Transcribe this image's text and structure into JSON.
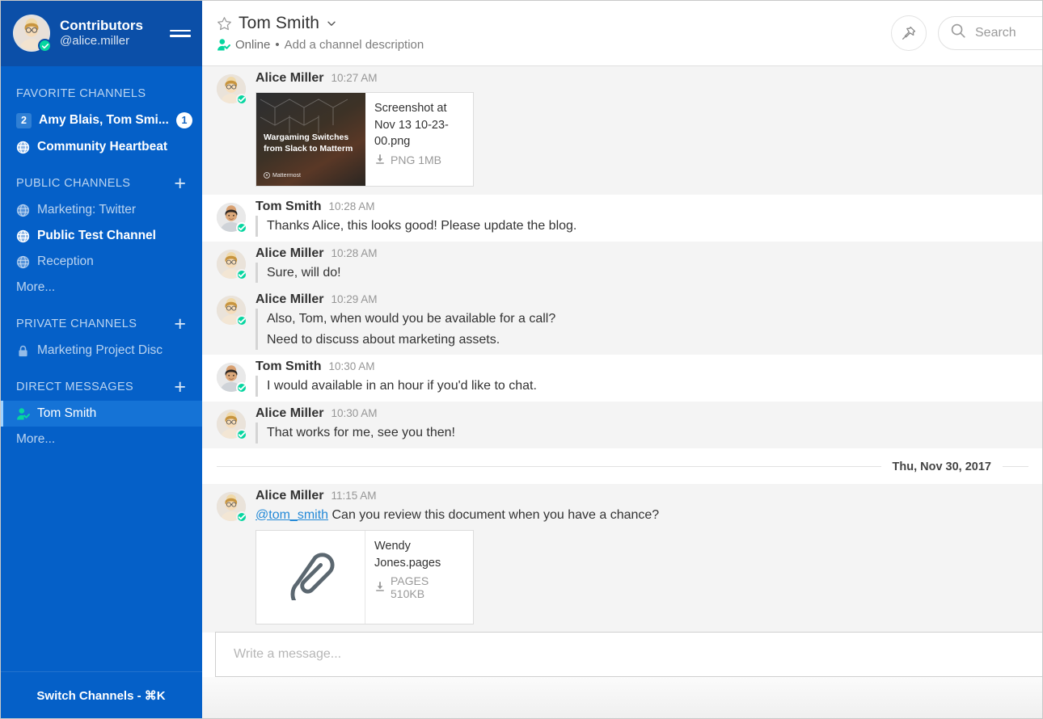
{
  "colors": {
    "sidebar_bg": "#0560c8",
    "sidebar_header_bg": "#0b4fa8",
    "sidebar_active": "#1573d6",
    "online_green": "#06d6a0",
    "mention_link": "#2389d7",
    "post_highlight": "#f4f4f4"
  },
  "sidebar": {
    "team_name": "Contributors",
    "user_handle": "@alice.miller",
    "menu_icon": "hamburger-icon",
    "categories": [
      {
        "label": "FAVORITE CHANNELS",
        "has_add": false,
        "add_label": "+",
        "items": [
          {
            "name": "Amy Blais, Tom Smi...",
            "icon": "group-count-icon",
            "count": "2",
            "mentions": "1",
            "unread": true,
            "active": false
          },
          {
            "name": "Community Heartbeat",
            "icon": "globe-icon",
            "unread": true,
            "active": false
          }
        ],
        "more": null
      },
      {
        "label": "PUBLIC CHANNELS",
        "has_add": true,
        "add_label": "+",
        "items": [
          {
            "name": "Marketing: Twitter",
            "icon": "globe-icon",
            "unread": false,
            "active": false
          },
          {
            "name": "Public Test Channel",
            "icon": "globe-icon",
            "unread": true,
            "active": false
          },
          {
            "name": "Reception",
            "icon": "globe-icon",
            "unread": false,
            "active": false
          }
        ],
        "more": "More..."
      },
      {
        "label": "PRIVATE CHANNELS",
        "has_add": true,
        "add_label": "+",
        "items": [
          {
            "name": "Marketing Project Disc",
            "icon": "lock-icon",
            "unread": false,
            "active": false
          }
        ],
        "more": null
      },
      {
        "label": "DIRECT MESSAGES",
        "has_add": true,
        "add_label": "+",
        "items": [
          {
            "name": "Tom Smith",
            "icon": "online-person-icon",
            "unread": false,
            "active": true
          }
        ],
        "more": "More..."
      }
    ],
    "footer_label": "Switch Channels - ⌘K"
  },
  "channel_header": {
    "favorite_icon": "star-icon",
    "title": "Tom Smith",
    "dropdown_icon": "chevron-down-icon",
    "status_icon": "online-person-icon",
    "status_text": "Online",
    "separator": "•",
    "description_placeholder": "Add a channel description",
    "pin_icon": "pin-icon",
    "search_icon": "search-icon",
    "search_placeholder": "Search",
    "search_value": ""
  },
  "posts": [
    {
      "author": "Alice Miller",
      "avatar": "alice",
      "time": "10:27 AM",
      "highlight": true,
      "lines": [],
      "attachment": {
        "kind": "image",
        "thumb_title": "Wargaming Switches from Slack to Matterm",
        "thumb_brand": "Mattermost",
        "name": "Screenshot at Nov 13 10-23-00.png",
        "meta": "PNG 1MB",
        "download_icon": "download-icon"
      }
    },
    {
      "author": "Tom Smith",
      "avatar": "tom",
      "time": "10:28 AM",
      "highlight": false,
      "lines": [
        "Thanks Alice, this looks good! Please update the blog."
      ],
      "attachment": null
    },
    {
      "author": "Alice Miller",
      "avatar": "alice",
      "time": "10:28 AM",
      "highlight": true,
      "lines": [
        "Sure, will do!"
      ],
      "attachment": null
    },
    {
      "author": "Alice Miller",
      "avatar": "alice",
      "time": "10:29 AM",
      "highlight": true,
      "lines": [
        "Also, Tom, when would you be available for a call?",
        "Need to discuss about marketing assets."
      ],
      "attachment": null
    },
    {
      "author": "Tom Smith",
      "avatar": "tom",
      "time": "10:30 AM",
      "highlight": false,
      "lines": [
        "I would available in an hour if you'd like to chat."
      ],
      "attachment": null
    },
    {
      "author": "Alice Miller",
      "avatar": "alice",
      "time": "10:30 AM",
      "highlight": true,
      "lines": [
        "That works for me, see you then!"
      ],
      "attachment": null
    }
  ],
  "date_separator": "Thu, Nov 30, 2017",
  "posts_after": [
    {
      "author": "Alice Miller",
      "avatar": "alice",
      "time": "11:15 AM",
      "highlight": true,
      "mention": "@tom_smith",
      "lines": [
        " Can you review this document when you have a chance?"
      ],
      "attachment": {
        "kind": "file",
        "icon": "paperclip-icon",
        "name": "Wendy Jones.pages",
        "meta": "PAGES 510KB",
        "download_icon": "download-icon"
      }
    }
  ],
  "composer": {
    "placeholder": "Write a message...",
    "value": ""
  }
}
